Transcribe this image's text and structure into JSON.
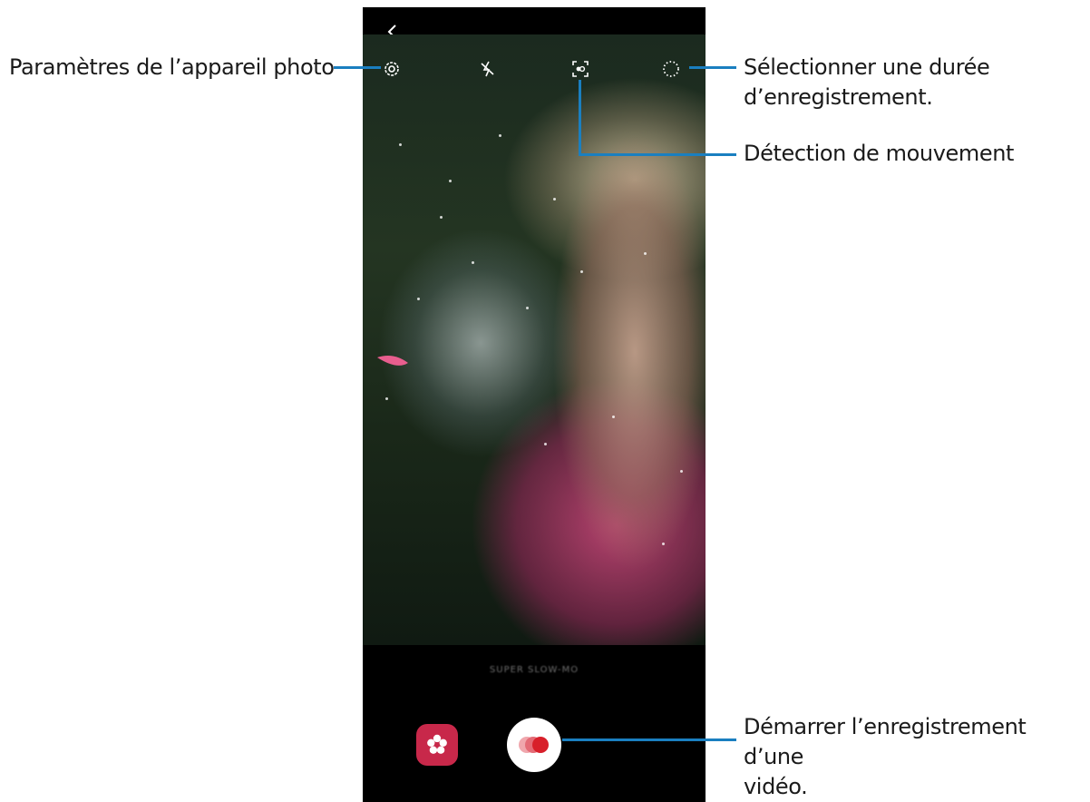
{
  "callouts": {
    "settings": "Paramètres de l’appareil photo",
    "duration_line1": "Sélectionner une durée",
    "duration_line2": "d’enregistrement.",
    "motion": "Détection de mouvement",
    "record_line1": "Démarrer l’enregistrement d’une",
    "record_line2": "vidéo."
  },
  "camera": {
    "mode_label": "SUPER SLOW-MO"
  },
  "colors": {
    "callout_line": "#1a7fc0",
    "gallery_button": "#c8284a",
    "record_dot_front": "#d81f2a",
    "record_dot_back": "#f0a7ad"
  },
  "icons": {
    "back": "chevron-left-icon",
    "settings": "gear-icon",
    "flash": "flash-off-icon",
    "motion": "motion-detection-icon",
    "duration": "dotted-circle-icon",
    "gallery": "flower-icon",
    "record": "super-slow-mo-record-icon"
  }
}
